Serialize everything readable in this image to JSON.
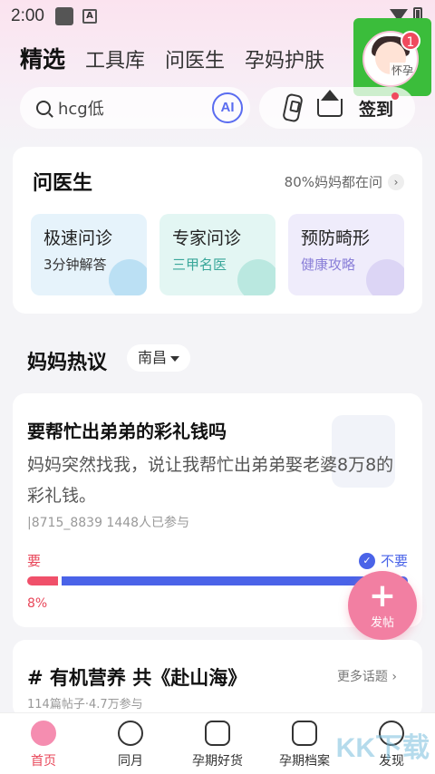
{
  "status_bar": {
    "time": "2:00"
  },
  "tabs": [
    "精选",
    "工具库",
    "问医生",
    "孕妈护肤"
  ],
  "avatar": {
    "badge": "1",
    "label": "怀孕"
  },
  "search": {
    "placeholder": "hcg低",
    "ai_label": "AI"
  },
  "actions": {
    "signin_label": "签到"
  },
  "doctor_card": {
    "title": "问医生",
    "more": "80%妈妈都在问",
    "services": [
      {
        "title": "极速问诊",
        "subtitle": "3分钟解答",
        "color": "#e6f3fb",
        "sub_color": "#333333"
      },
      {
        "title": "专家问诊",
        "subtitle": "三甲名医",
        "color": "#e3f6f3",
        "sub_color": "#3aa79a"
      },
      {
        "title": "预防畸形",
        "subtitle": "健康攻略",
        "color": "#efecfb",
        "sub_color": "#8a7fd8"
      }
    ]
  },
  "hot": {
    "title": "妈妈热议",
    "city": "南昌"
  },
  "post": {
    "title": "要帮忙出弟弟的彩礼钱吗",
    "body": "妈妈突然找我，说让我帮忙出弟弟娶老婆8万8的彩礼钱。",
    "meta": "|8715_8839   1448人已参与",
    "yes_label": "要",
    "no_label": "不要",
    "yes_share": 0.08,
    "yes_pct": "8%"
  },
  "fab": {
    "label": "发帖"
  },
  "topic": {
    "title": "# 有机营养 共《赴山海》",
    "more": "更多话题  ›",
    "meta": "114篇帖子·4.7万参与"
  },
  "bottom_nav": [
    "首页",
    "同月",
    "孕期好货",
    "孕期档案",
    "发现"
  ],
  "watermark": "KK下载",
  "colors": {
    "accent": "#e8475a",
    "blue": "#4a63e8",
    "fab": "#f27fa2"
  }
}
